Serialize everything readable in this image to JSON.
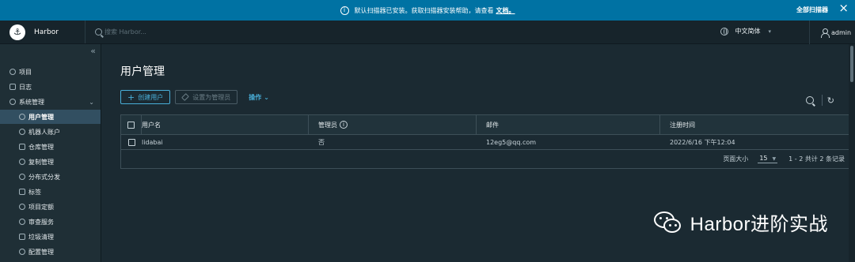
{
  "banner": {
    "message": "默认扫描器已安装。获取扫描器安装帮助，请查看",
    "link": "文档。",
    "scan_all": "全部扫描器"
  },
  "header": {
    "brand": "Harbor",
    "search_placeholder": "搜索 Harbor...",
    "language": "中文简体",
    "user": "admin"
  },
  "sidebar": {
    "items": [
      {
        "label": "项目"
      },
      {
        "label": "日志"
      },
      {
        "label": "系统管理"
      }
    ],
    "sub_items": [
      {
        "label": "用户管理"
      },
      {
        "label": "机器人账户"
      },
      {
        "label": "仓库管理"
      },
      {
        "label": "复制管理"
      },
      {
        "label": "分布式分发"
      },
      {
        "label": "标签"
      },
      {
        "label": "项目定额"
      },
      {
        "label": "审查服务"
      },
      {
        "label": "垃圾清理"
      },
      {
        "label": "配置管理"
      }
    ]
  },
  "main": {
    "title": "用户管理",
    "toolbar": {
      "create_user": "创建用户",
      "set_admin": "设置为管理员",
      "actions": "操作"
    },
    "table": {
      "columns": [
        "用户名",
        "管理员",
        "邮件",
        "注册时间"
      ],
      "rows": [
        {
          "username": "lidabai",
          "admin": "否",
          "email": "12eg5@qq.com",
          "registered": "2022/6/16 下午12:04"
        }
      ]
    },
    "pagination": {
      "page_size_label": "页面大小",
      "page_size": "15",
      "summary": "1 - 2 共计 2 条记录"
    }
  },
  "watermark": {
    "text": "Harbor进阶实战"
  }
}
